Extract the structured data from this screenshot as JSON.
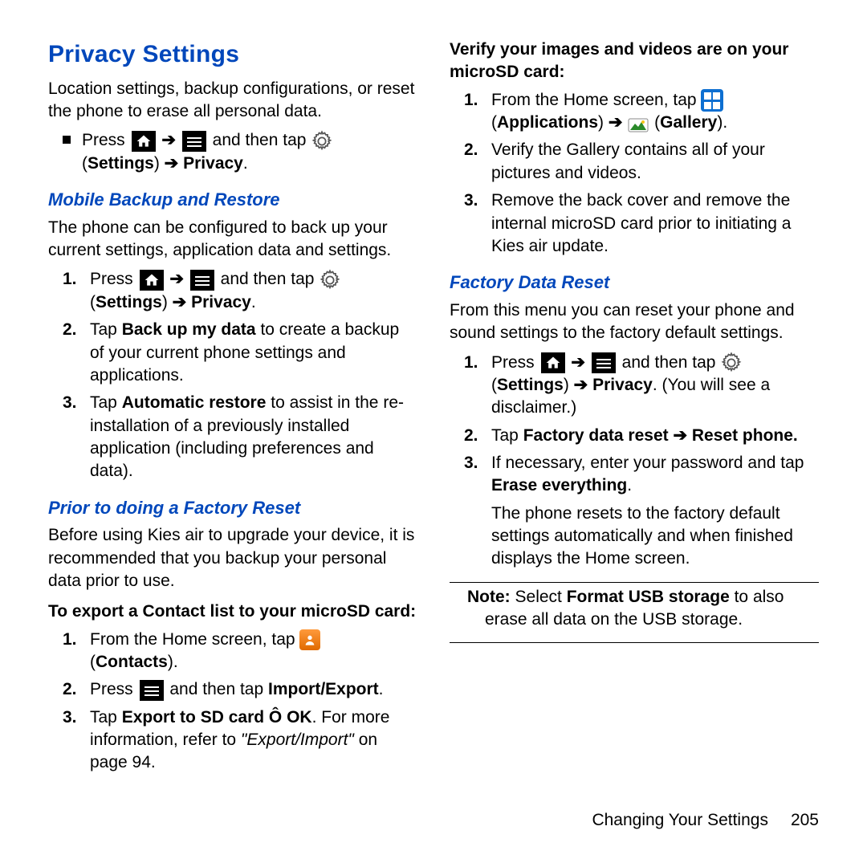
{
  "title": "Privacy Settings",
  "intro": "Location settings, backup configurations, or reset the phone to erase all personal data.",
  "press": "Press",
  "and_then_tap": "and then tap",
  "settings_label": "Settings",
  "privacy_label": "Privacy",
  "arrow": "➔",
  "section_backup": "Mobile Backup and Restore",
  "backup_intro": "The phone can be configured to back up your current settings, application data and settings.",
  "step_tap": "Tap",
  "backup_bold": "Back up my data",
  "backup_rest": " to create a backup of your current phone settings and applications.",
  "autorestore_bold": "Automatic restore",
  "autorestore_rest": " to assist in the re-installation of a previously installed application (including preferences and data).",
  "section_prior": "Prior to doing a Factory Reset",
  "prior_intro": "Before using Kies air to upgrade your device, it is recommended that you backup your personal data prior to use.",
  "export_contacts_head": "To export a Contact list to your microSD card:",
  "from_home_tap": "From the Home screen, tap",
  "contacts_label": "Contacts",
  "import_export": "Import/Export",
  "export_sd_bold": "Export to SD card Ô OK",
  "export_sd_rest": ". For more information, refer to ",
  "export_import_ref": "\"Export/Import\"",
  "on_page": " on page 94.",
  "verify_head": "Verify your images and videos are on your microSD card:",
  "applications_label": "Applications",
  "gallery_label": "Gallery",
  "verify_gallery": "Verify the Gallery contains all of your pictures and videos.",
  "remove_cover": "Remove the back cover and remove the internal microSD card prior to initiating a Kies air update.",
  "section_factory": "Factory Data Reset",
  "factory_intro": "From this menu you can reset your phone and sound settings to the factory default settings.",
  "disclaimer_text": ". (You will see a disclaimer.)",
  "factory_reset_bold": "Factory data reset ➔ Reset phone.",
  "password_text": "If necessary, enter your password and tap ",
  "erase_everything": "Erase everything",
  "reset_result": "The phone resets to the factory default settings automatically and when finished displays the Home screen.",
  "note_prefix": "Note:",
  "note_pre": " Select ",
  "format_usb": "Format USB storage",
  "note_post": " to also erase all data on the USB storage.",
  "footer_section": "Changing Your Settings",
  "footer_page": "205"
}
